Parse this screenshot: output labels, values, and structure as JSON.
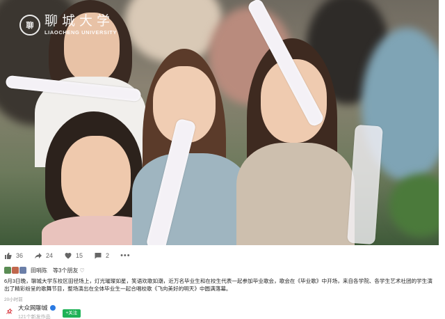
{
  "photo": {
    "logo_seal": "聊",
    "logo_cn": "聊城大学",
    "logo_en": "LIAOCHENG UNIVERSITY"
  },
  "actions": {
    "like_count": "36",
    "share_count": "24",
    "fav_count": "15",
    "comment_count": "2",
    "more": "•••"
  },
  "friends": {
    "name": "田哨陈",
    "text": "等3个朋友",
    "heart": "♡"
  },
  "caption": "6月3日晚，聊城大学东校区田径场上，灯光璀璨如星，笑语欢歌如潮，近万名毕业生和在校生代表一起参加毕业歌会，歌会在《毕业歌》中开场，来自各学院、各学生艺术社团的学生演出了精彩纷呈的歌舞节目，整场演出在全体毕业生一起合唱校歌《飞向美好的明天》中圆满落幕。",
  "time": "20小时前",
  "author": {
    "avatar_mark": "众",
    "name": "大众网聊城",
    "sub": "121个新发作品",
    "follow": "+关注"
  }
}
